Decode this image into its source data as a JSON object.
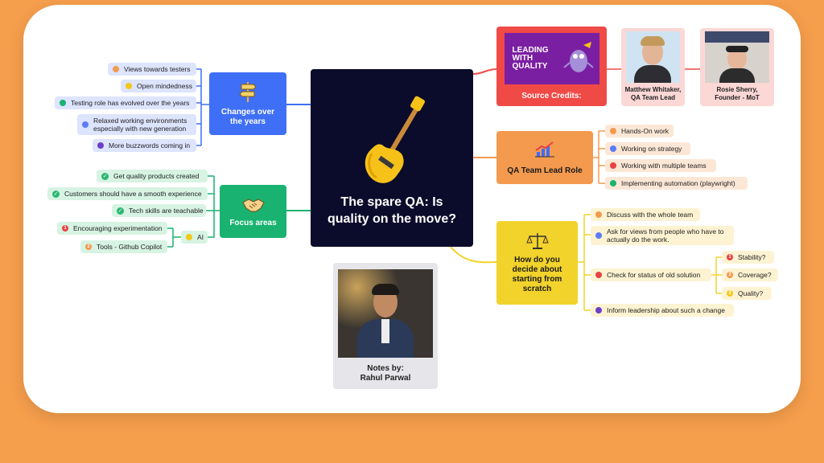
{
  "central": {
    "title": "The spare QA: Is quality on the move?"
  },
  "changes": {
    "label": "Changes over the years",
    "items": [
      "Views towards testers",
      "Open mindedness",
      "Testing role has evolved over the years",
      "Relaxed working environments especially with new generation",
      "More buzzwords coming in"
    ]
  },
  "focus": {
    "label": "Focus areas",
    "items": [
      "Get quality products created",
      "Customers should have a smooth experience",
      "Tech skills are teachable"
    ],
    "ai": {
      "label": "AI",
      "items": [
        "Encouraging experimentation",
        "Tools - Github Copilot"
      ],
      "numbers": [
        "1",
        "2"
      ]
    }
  },
  "credits": {
    "label": "Source Credits:",
    "logo_lines": [
      "LEADING",
      "WITH",
      "QUALITY"
    ],
    "people": [
      {
        "name": "Matthew Whitaker,",
        "role": "QA Team Lead"
      },
      {
        "name": "Rosie Sherry,",
        "role": "Founder - MoT"
      }
    ]
  },
  "teamlead": {
    "label": "QA Team Lead Role",
    "items": [
      "Hands-On work",
      "Working on strategy",
      "Working with multiple teams",
      "Implementing automation (playwright)"
    ]
  },
  "decide": {
    "label": "How do you decide about starting from scratch",
    "items": [
      "Discuss with the whole team",
      "Ask for views from people who have to actually do the work.",
      "Check for status of old solution",
      "Inform leadership about such a change"
    ],
    "sub": [
      "Stability?",
      "Coverage?",
      "Quality?"
    ],
    "sub_numbers": [
      "1",
      "2",
      "3"
    ]
  },
  "notes": {
    "line1": "Notes by:",
    "line2": "Rahul Parwal"
  },
  "colors": {
    "background": "#F59E4C",
    "central": "#0B0B2B",
    "changes": "#3F6FF6",
    "focus": "#19B271",
    "credits": "#F04A46",
    "teamlead": "#F39A4F",
    "decide": "#F2D32B"
  }
}
